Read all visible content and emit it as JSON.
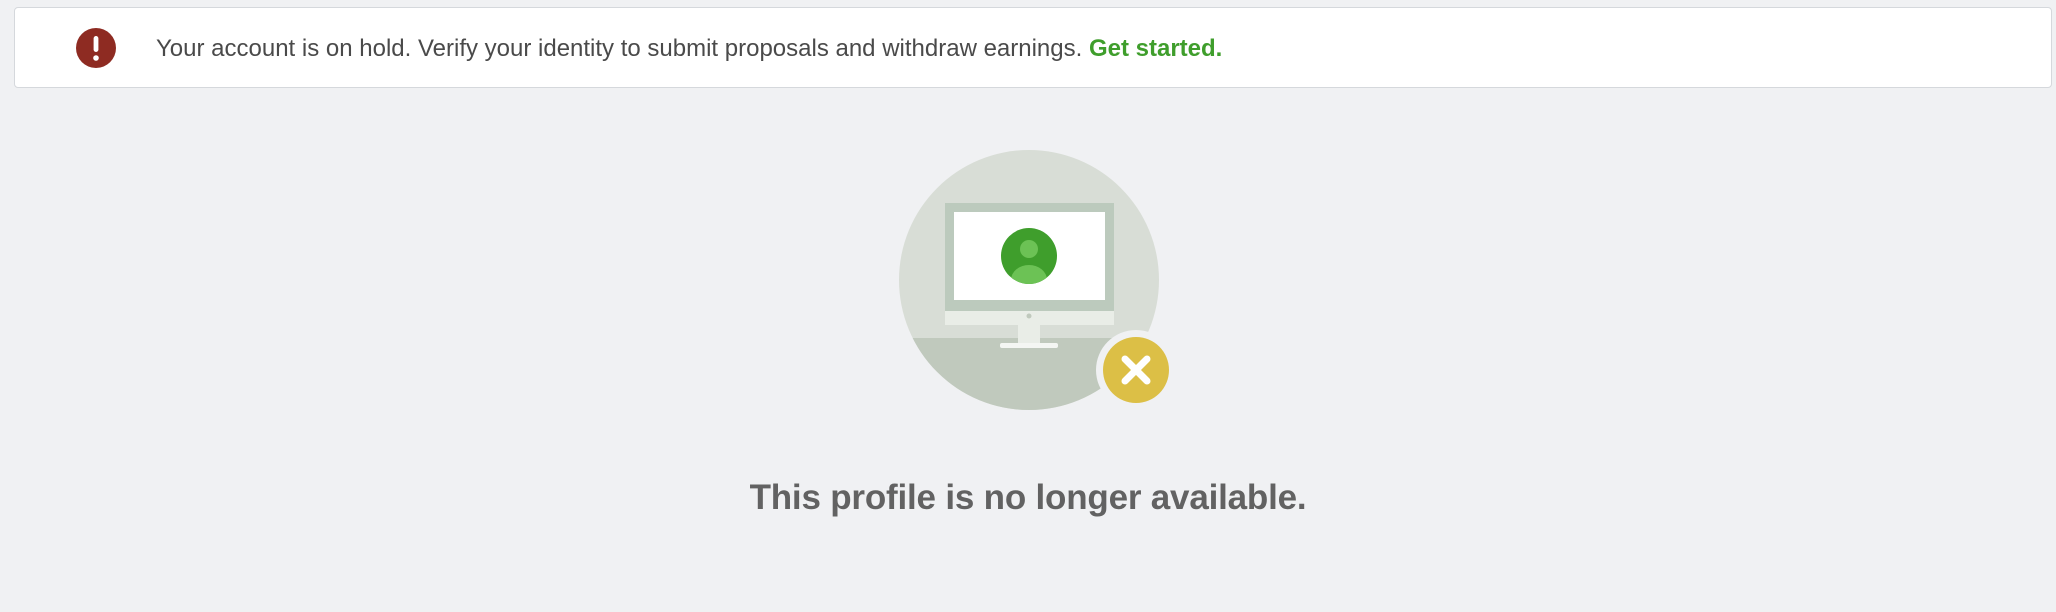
{
  "alert": {
    "icon": "exclamation-icon",
    "message": "Your account is on hold. Verify your identity to submit proposals and withdraw earnings.",
    "link_label": "Get started.",
    "colors": {
      "icon_bg": "#8e2b22",
      "link": "#3f9e2c"
    }
  },
  "empty_state": {
    "illustration": "monitor-profile-unavailable-illustration",
    "badge_icon": "close-x-icon",
    "headline": "This profile is no longer available."
  }
}
